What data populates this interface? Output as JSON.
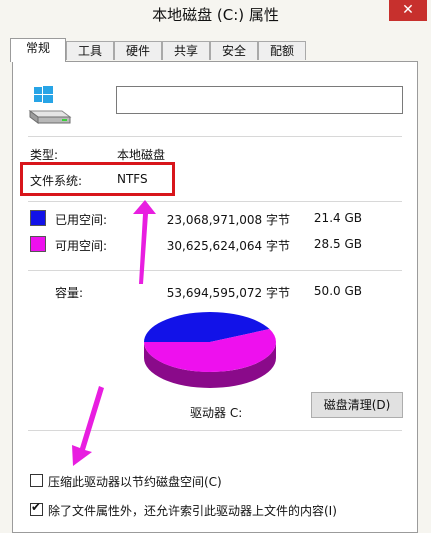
{
  "window": {
    "title": "本地磁盘 (C:) 属性",
    "close_glyph": "✕"
  },
  "tabs": [
    {
      "label": "常规",
      "active": true
    },
    {
      "label": "工具",
      "active": false
    },
    {
      "label": "硬件",
      "active": false
    },
    {
      "label": "共享",
      "active": false
    },
    {
      "label": "安全",
      "active": false
    },
    {
      "label": "配额",
      "active": false
    }
  ],
  "general": {
    "drive_icon": "hard-drive-windows-icon",
    "name_value": "",
    "type_label": "类型:",
    "type_value": "本地磁盘",
    "fs_label": "文件系统:",
    "fs_value": "NTFS",
    "used": {
      "label": "已用空间:",
      "bytes": "23,068,971,008 字节",
      "size": "21.4 GB",
      "color": "#1212e8"
    },
    "free": {
      "label": "可用空间:",
      "bytes": "30,625,624,064 字节",
      "size": "28.5 GB",
      "color": "#ee10ee"
    },
    "capacity": {
      "label": "容量:",
      "bytes": "53,694,595,072 字节",
      "size": "50.0 GB"
    },
    "drive_caption": "驱动器 C:",
    "cleanup_label": "磁盘清理(D)",
    "compress_label": "压缩此驱动器以节约磁盘空间(C)",
    "compress_checked": false,
    "index_label": "除了文件属性外，还允许索引此驱动器上文件的内容(I)",
    "index_checked": true
  },
  "annotation_color": "#d8151b",
  "arrow_color": "#e81ee0",
  "chart_data": {
    "type": "pie",
    "categories": [
      "已用空间",
      "可用空间"
    ],
    "values": [
      21.4,
      28.5
    ],
    "colors": [
      "#1212e8",
      "#ee10ee"
    ]
  }
}
